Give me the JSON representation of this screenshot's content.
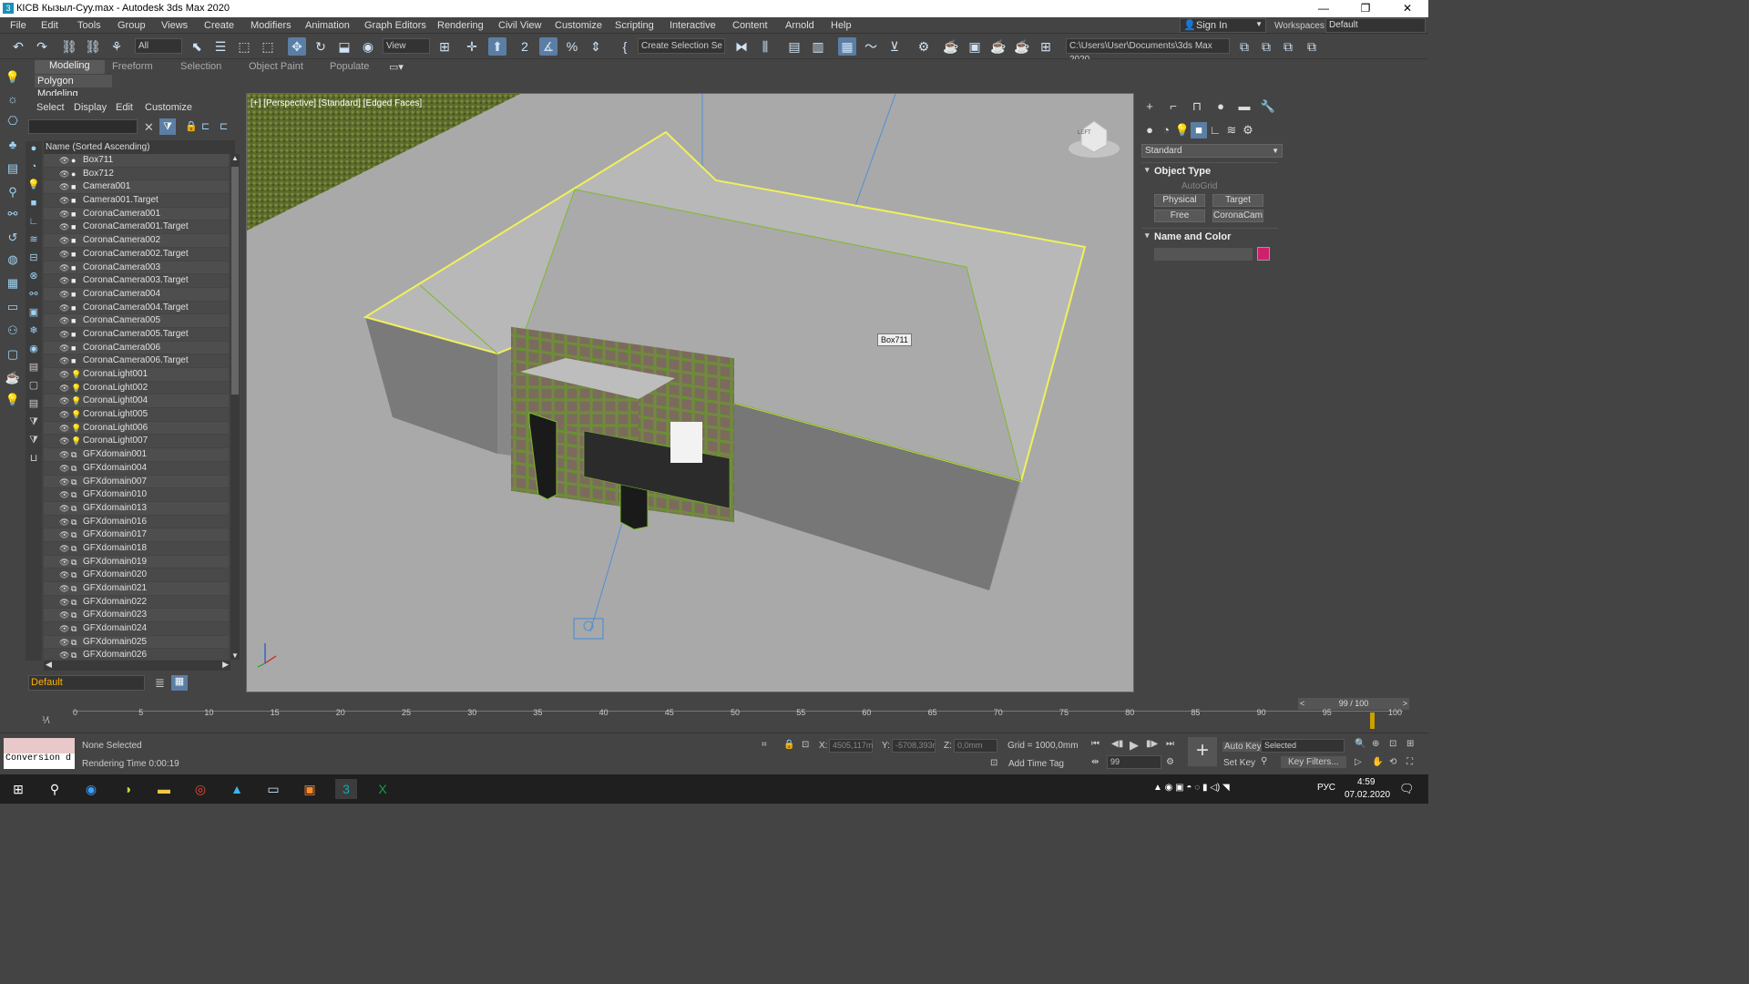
{
  "title_bar": {
    "title": "КІСВ Кызыл-Суу.max - Autodesk 3ds Max 2020",
    "min": "—",
    "max": "❐",
    "close": "✕"
  },
  "menu": [
    "File",
    "Edit",
    "Tools",
    "Group",
    "Views",
    "Create",
    "Modifiers",
    "Animation",
    "Graph Editors",
    "Rendering",
    "Civil View",
    "Customize",
    "Scripting",
    "Interactive",
    "Content",
    "Arnold",
    "Help"
  ],
  "account": {
    "sign_in": "Sign In",
    "workspaces_label": "Workspaces:",
    "workspace": "Default"
  },
  "toolbar": {
    "filter": "All",
    "ref_coord": "View",
    "selection_set": "Create Selection Se",
    "project_path": "C:\\Users\\User\\Documents\\3ds Max 2020"
  },
  "ribbon": {
    "tabs": [
      "Modeling",
      "Freeform",
      "Selection",
      "Object Paint",
      "Populate"
    ],
    "active": "Modeling",
    "panel": "Polygon Modeling"
  },
  "scene_explorer": {
    "menu": [
      "Select",
      "Display",
      "Edit",
      "Customize"
    ],
    "column_header": "Name (Sorted Ascending)",
    "items": [
      {
        "name": "Box711",
        "icon": "sphere-icon"
      },
      {
        "name": "Box712",
        "icon": "sphere-icon"
      },
      {
        "name": "Camera001",
        "icon": "camera-icon"
      },
      {
        "name": "Camera001.Target",
        "icon": "camera-icon"
      },
      {
        "name": "CoronaCamera001",
        "icon": "camera-icon"
      },
      {
        "name": "CoronaCamera001.Target",
        "icon": "camera-icon"
      },
      {
        "name": "CoronaCamera002",
        "icon": "camera-icon"
      },
      {
        "name": "CoronaCamera002.Target",
        "icon": "camera-icon"
      },
      {
        "name": "CoronaCamera003",
        "icon": "camera-icon"
      },
      {
        "name": "CoronaCamera003.Target",
        "icon": "camera-icon"
      },
      {
        "name": "CoronaCamera004",
        "icon": "camera-icon"
      },
      {
        "name": "CoronaCamera004.Target",
        "icon": "camera-icon"
      },
      {
        "name": "CoronaCamera005",
        "icon": "camera-icon"
      },
      {
        "name": "CoronaCamera005.Target",
        "icon": "camera-icon"
      },
      {
        "name": "CoronaCamera006",
        "icon": "camera-icon"
      },
      {
        "name": "CoronaCamera006.Target",
        "icon": "camera-icon"
      },
      {
        "name": "CoronaLight001",
        "icon": "light-icon"
      },
      {
        "name": "CoronaLight002",
        "icon": "light-icon"
      },
      {
        "name": "CoronaLight004",
        "icon": "light-icon"
      },
      {
        "name": "CoronaLight005",
        "icon": "light-icon"
      },
      {
        "name": "CoronaLight006",
        "icon": "light-icon"
      },
      {
        "name": "CoronaLight007",
        "icon": "light-icon"
      },
      {
        "name": "GFXdomain001",
        "icon": "domain-icon"
      },
      {
        "name": "GFXdomain004",
        "icon": "domain-icon"
      },
      {
        "name": "GFXdomain007",
        "icon": "domain-icon"
      },
      {
        "name": "GFXdomain010",
        "icon": "domain-icon"
      },
      {
        "name": "GFXdomain013",
        "icon": "domain-icon"
      },
      {
        "name": "GFXdomain016",
        "icon": "domain-icon"
      },
      {
        "name": "GFXdomain017",
        "icon": "domain-icon"
      },
      {
        "name": "GFXdomain018",
        "icon": "domain-icon"
      },
      {
        "name": "GFXdomain019",
        "icon": "domain-icon"
      },
      {
        "name": "GFXdomain020",
        "icon": "domain-icon"
      },
      {
        "name": "GFXdomain021",
        "icon": "domain-icon"
      },
      {
        "name": "GFXdomain022",
        "icon": "domain-icon"
      },
      {
        "name": "GFXdomain023",
        "icon": "domain-icon"
      },
      {
        "name": "GFXdomain024",
        "icon": "domain-icon"
      },
      {
        "name": "GFXdomain025",
        "icon": "domain-icon"
      },
      {
        "name": "GFXdomain026",
        "icon": "domain-icon"
      }
    ],
    "layer": "Default"
  },
  "viewport": {
    "label": "[+] [Perspective] [Standard] [Edged Faces]",
    "tooltip": "Box711",
    "viewcube_face": "LEFT"
  },
  "command_panel": {
    "category": "Standard",
    "object_type": {
      "title": "Object Type",
      "autogrid": "AutoGrid",
      "buttons": [
        "Physical",
        "Target",
        "Free",
        "CoronaCam"
      ]
    },
    "name_color": {
      "title": "Name and Color",
      "color": "#d0206c"
    }
  },
  "timeline": {
    "frame": "99 / 100",
    "ticks": [
      "0",
      "5",
      "10",
      "15",
      "20",
      "25",
      "30",
      "35",
      "40",
      "45",
      "50",
      "55",
      "60",
      "65",
      "70",
      "75",
      "80",
      "85",
      "90",
      "95",
      "100"
    ]
  },
  "status": {
    "selection": "None Selected",
    "render_time": "Rendering Time  0:00:19",
    "maxscript": "Conversion d",
    "x_label": "X:",
    "x": "4505,117m",
    "y_label": "Y:",
    "y": "-5708,393r",
    "z_label": "Z:",
    "z": "0,0mm",
    "grid": "Grid = 1000,0mm",
    "add_time_tag": "Add Time Tag",
    "auto_key": "Auto Key",
    "set_key": "Set Key",
    "key_mode": "Selected",
    "key_filters": "Key Filters...",
    "current_frame": "99"
  },
  "taskbar": {
    "lang": "РУС",
    "time": "4:59",
    "date": "07.02.2020"
  }
}
